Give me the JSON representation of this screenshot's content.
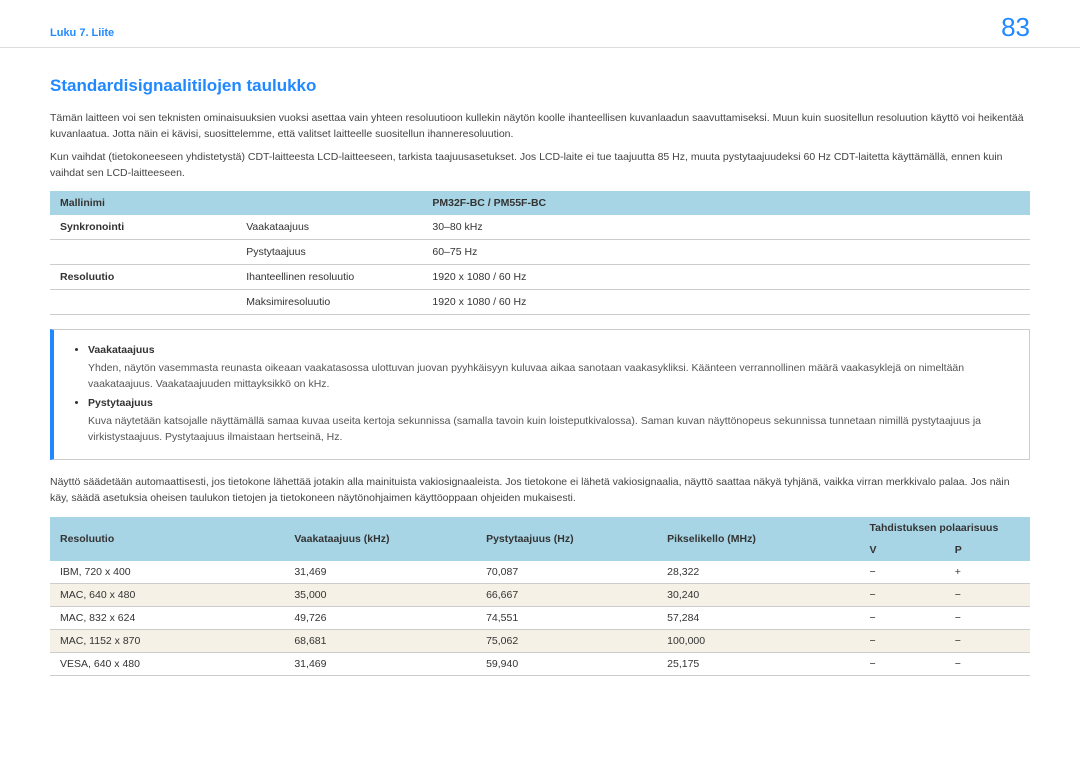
{
  "header": {
    "chapter": "Luku 7. Liite",
    "page": "83"
  },
  "section_title": "Standardisignaalitilojen taulukko",
  "paragraphs": {
    "p1": "Tämän laitteen voi sen teknisten ominaisuuksien vuoksi asettaa vain yhteen resoluutioon kullekin näytön koolle ihanteellisen kuvanlaadun saavuttamiseksi. Muun kuin suositellun resoluution käyttö voi heikentää kuvanlaatua. Jotta näin ei kävisi, suosittelemme, että valitset laitteelle suositellun ihanneresoluution.",
    "p2": "Kun vaihdat (tietokoneeseen yhdistetystä) CDT-laitteesta LCD-laitteeseen, tarkista taajuusasetukset. Jos LCD-laite ei tue taajuutta 85 Hz, muuta pystytaajuudeksi 60 Hz CDT-laitetta käyttämällä, ennen kuin vaihdat sen LCD-laitteeseen.",
    "p3": "Näyttö säädetään automaattisesti, jos tietokone lähettää jotakin alla mainituista vakiosignaaleista. Jos tietokone ei lähetä vakiosignaalia, näyttö saattaa näkyä tyhjänä, vaikka virran merkkivalo palaa. Jos näin käy, säädä asetuksia oheisen taulukon tietojen ja tietokoneen näytönohjaimen käyttöoppaan ohjeiden mukaisesti."
  },
  "table1": {
    "h1": "Mallinimi",
    "h2": "PM32F-BC / PM55F-BC",
    "rows": [
      {
        "group": "Synkronointi",
        "param": "Vaakataajuus",
        "val": "30–80 kHz"
      },
      {
        "group": "",
        "param": "Pystytaajuus",
        "val": "60–75 Hz"
      },
      {
        "group": "Resoluutio",
        "param": "Ihanteellinen resoluutio",
        "val": "1920 x 1080 / 60 Hz"
      },
      {
        "group": "",
        "param": "Maksimiresoluutio",
        "val": "1920 x 1080 / 60 Hz"
      }
    ]
  },
  "notes": {
    "n1_term": "Vaakataajuus",
    "n1_desc": "Yhden, näytön vasemmasta reunasta oikeaan vaakatasossa ulottuvan juovan pyyhkäisyyn kuluvaa aikaa sanotaan vaakasykliksi. Käänteen verrannollinen määrä vaakasyklejä on nimeltään vaakataajuus. Vaakataajuuden mittayksikkö on kHz.",
    "n2_term": "Pystytaajuus",
    "n2_desc": "Kuva näytetään katsojalle näyttämällä samaa kuvaa useita kertoja sekunnissa (samalla tavoin kuin loisteputkivalossa). Saman kuvan näyttönopeus sekunnissa tunnetaan nimillä pystytaajuus ja virkistystaajuus. Pystytaajuus ilmaistaan hertseinä, Hz."
  },
  "table2": {
    "headers": {
      "c1": "Resoluutio",
      "c2": "Vaakataajuus (kHz)",
      "c3": "Pystytaajuus (Hz)",
      "c4": "Pikselikello (MHz)",
      "c5": "Tahdistuksen polaarisuus",
      "sub_v": "V",
      "sub_p": "P"
    },
    "rows": [
      {
        "res": "IBM, 720 x 400",
        "hf": "31,469",
        "vf": "70,087",
        "pc": "28,322",
        "v": "−",
        "p": "+"
      },
      {
        "res": "MAC, 640 x 480",
        "hf": "35,000",
        "vf": "66,667",
        "pc": "30,240",
        "v": "−",
        "p": "−"
      },
      {
        "res": "MAC, 832 x 624",
        "hf": "49,726",
        "vf": "74,551",
        "pc": "57,284",
        "v": "−",
        "p": "−"
      },
      {
        "res": "MAC, 1152 x 870",
        "hf": "68,681",
        "vf": "75,062",
        "pc": "100,000",
        "v": "−",
        "p": "−"
      },
      {
        "res": "VESA, 640 x 480",
        "hf": "31,469",
        "vf": "59,940",
        "pc": "25,175",
        "v": "−",
        "p": "−"
      }
    ]
  }
}
